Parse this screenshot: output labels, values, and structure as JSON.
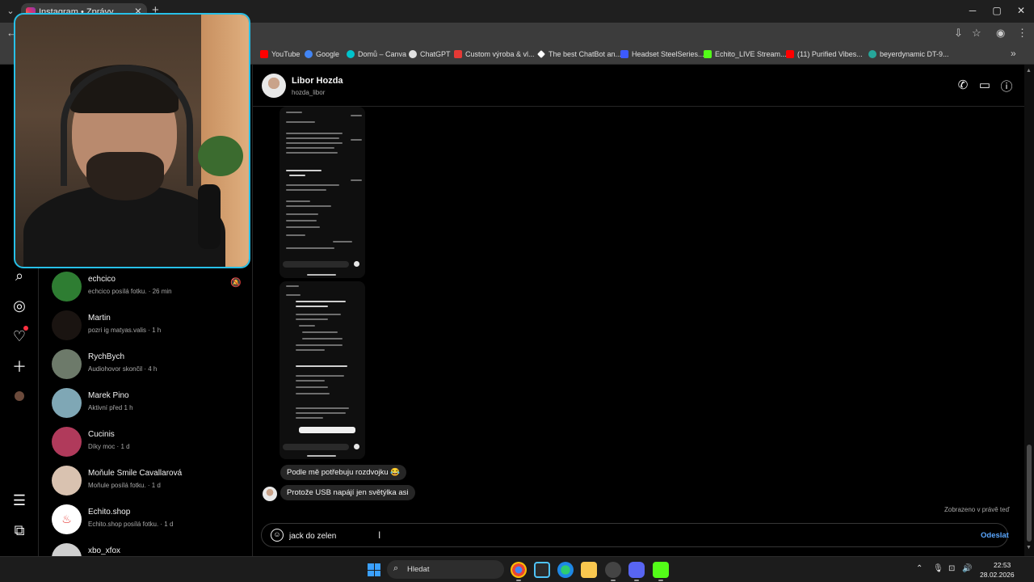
{
  "browser": {
    "tab_title": "Instagram • Zprávy",
    "new_tab": "+",
    "tab_close": "✕",
    "window": {
      "minimize": "─",
      "maximize": "▢",
      "close": "✕"
    },
    "bookmarks": [
      {
        "label": "YouTube",
        "icon": "youtube-icon",
        "color": "#ff0000"
      },
      {
        "label": "Google",
        "icon": "google-icon",
        "color": "#4285f4"
      },
      {
        "label": "Domů – Canva",
        "icon": "canva-icon",
        "color": "#00c4cc"
      },
      {
        "label": "ChatGPT",
        "icon": "chatgpt-icon",
        "color": "#e0e0e0"
      },
      {
        "label": "Custom výroba & vl...",
        "icon": "custom-icon",
        "color": "#e53935"
      },
      {
        "label": "The best ChatBot an...",
        "icon": "chatbot-icon",
        "color": "#ffffff"
      },
      {
        "label": "Headset SteelSeries...",
        "icon": "steelseries-icon",
        "color": "#3d5afe"
      },
      {
        "label": "Echito_LIVE Stream...",
        "icon": "kick-icon",
        "color": "#53fc18"
      },
      {
        "label": "(11) Purified Vibes...",
        "icon": "youtube-icon",
        "color": "#ff0000"
      },
      {
        "label": "beyerdynamic DT-9...",
        "icon": "beyerdynamic-icon",
        "color": "#26a69a"
      }
    ]
  },
  "conversations": [
    {
      "name": "echcico",
      "sub": "echcico posílá fotku. · 26 min",
      "muted": true,
      "avatar_color": "#2e7d32"
    },
    {
      "name": "Martin",
      "sub": "pozri ig matyas.valis · 1 h",
      "muted": false,
      "avatar_color": "#3a2a22"
    },
    {
      "name": "RychBych",
      "sub": "Audiohovor skončil · 4 h",
      "muted": false,
      "avatar_color": "#6d7a6a"
    },
    {
      "name": "Marek Pino",
      "sub": "Aktivní před 1 h",
      "muted": false,
      "avatar_color": "#7fa7b5"
    },
    {
      "name": "Cucinis",
      "sub": "Díky moc · 1 d",
      "muted": false,
      "avatar_color": "#b03a5b"
    },
    {
      "name": "Moňule Smile Cavallarová",
      "sub": "Moňule posílá fotku. · 1 d",
      "muted": false,
      "avatar_color": "#d9c2b0"
    },
    {
      "name": "Echito.shop",
      "sub": "Echito.shop posílá fotku. · 1 d",
      "muted": false,
      "avatar_color": "#ffffff"
    },
    {
      "name": "xbo_xfox",
      "sub": "",
      "muted": false,
      "avatar_color": "#cfcfcf"
    }
  ],
  "chat": {
    "name": "Libor Hozda",
    "username": "hozda_libor",
    "messages": [
      {
        "text": "Podle mě potřebuju rozdvojku 😂",
        "sender": "other"
      },
      {
        "text": "Protože USB napájí jen světýlka asi",
        "sender": "other"
      }
    ],
    "seen": "Zobrazeno v právě teď",
    "composer_value": "jack do zelen",
    "send_label": "Odeslat"
  },
  "taskbar": {
    "search_label": "Hledat",
    "time": "22:53",
    "date": "28.02.2026"
  }
}
